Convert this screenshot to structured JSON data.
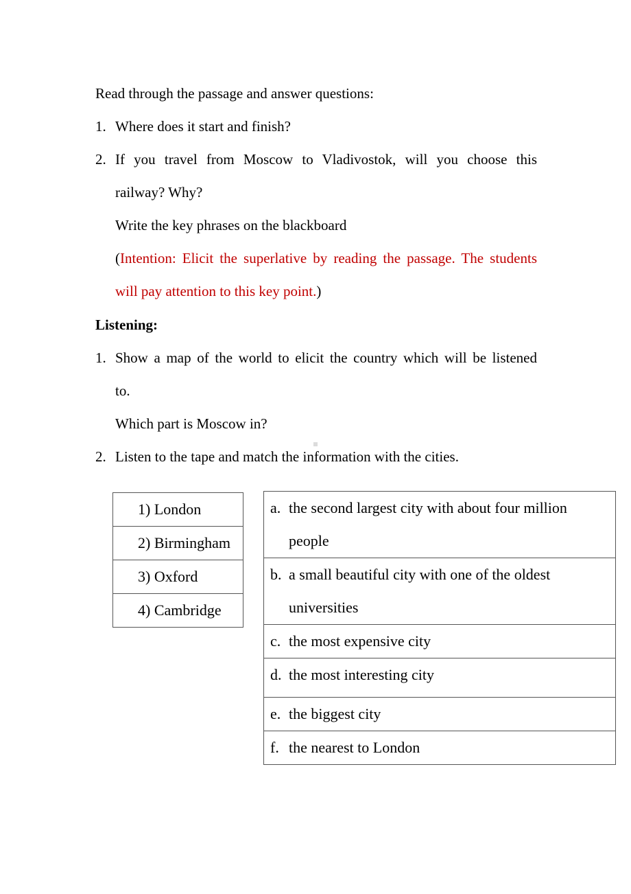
{
  "intro": "Read through the passage and answer questions:",
  "reading_questions": [
    {
      "num": "1.",
      "text": "Where does it start and finish?"
    },
    {
      "num": "2.",
      "line1": "If you travel from Moscow to Vladivostok, will you choose this",
      "line2": "railway? Why?"
    }
  ],
  "key_phrases_note": "Write the key phrases on the blackboard",
  "intention": {
    "open_paren": "(",
    "line1": "Intention: Elicit the superlative by reading the passage. The students",
    "line2": "will pay attention to this key point.",
    "close_paren": ")",
    "color": "#c00000"
  },
  "listening_heading": "Listening:",
  "listening_steps": [
    {
      "num": "1.",
      "line1": "Show a map of the world to elicit the country which will be listened",
      "line2": "to.",
      "followup": "Which part is Moscow in?"
    },
    {
      "num": "2.",
      "text": "Listen to the tape and match the information with the cities."
    }
  ],
  "cities": [
    {
      "num": "1)",
      "name": "London"
    },
    {
      "num": "2)",
      "name": "Birmingham"
    },
    {
      "num": "3)",
      "name": "Oxford"
    },
    {
      "num": "4)",
      "name": "Cambridge"
    }
  ],
  "information": [
    {
      "letter": "a.",
      "line1": "the second largest city with about four million",
      "line2": "people"
    },
    {
      "letter": "b.",
      "line1": "a small beautiful city with one of the oldest",
      "line2": "universities"
    },
    {
      "letter": "c.",
      "line1": "the most expensive city"
    },
    {
      "letter": "d.",
      "line1": "the most interesting city"
    },
    {
      "letter": "e.",
      "line1": "the biggest city"
    },
    {
      "letter": "f.",
      "line1": "the nearest to London"
    }
  ]
}
